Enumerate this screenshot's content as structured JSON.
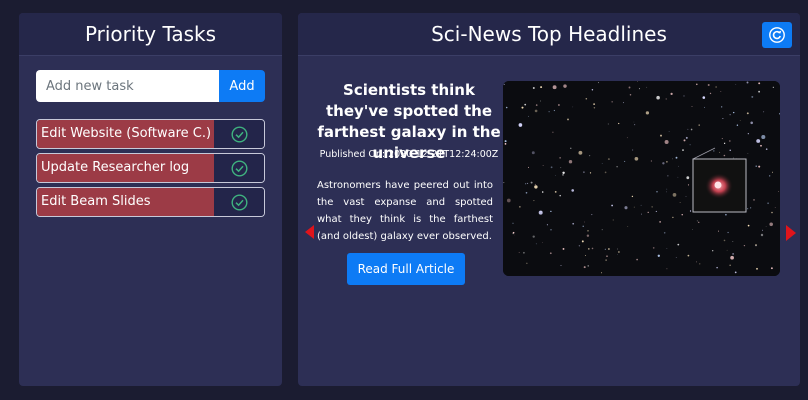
{
  "tasks_panel": {
    "title": "Priority Tasks",
    "input_placeholder": "Add new task",
    "add_label": "Add",
    "items": [
      {
        "label": "Edit Website (Software C.)",
        "check_icon": "check-circle-icon"
      },
      {
        "label": "Update Researcher log",
        "check_icon": "check-circle-icon"
      },
      {
        "label": "Edit Beam Slides",
        "check_icon": "check-circle-icon"
      }
    ]
  },
  "news_panel": {
    "title": "Sci-News Top Headlines",
    "refresh_icon": "refresh-icon",
    "article": {
      "title": "Scientists think they've spotted the farthest galaxy in the universe",
      "published": "Published On: 2020-12-21T12:24:00Z",
      "description": "Astronomers have peered out into the vast expanse and spotted what they think is the farthest (and oldest) galaxy ever observed.",
      "read_label": "Read Full Article"
    },
    "prev_icon": "triangle-left-icon",
    "next_icon": "triangle-right-icon"
  },
  "colors": {
    "background": "#1b1c31",
    "panel": "#2d2f55",
    "accent": "#0d7bf5",
    "task": "#9c3b46",
    "check": "#3fb27f",
    "arrow": "#e0141b"
  }
}
